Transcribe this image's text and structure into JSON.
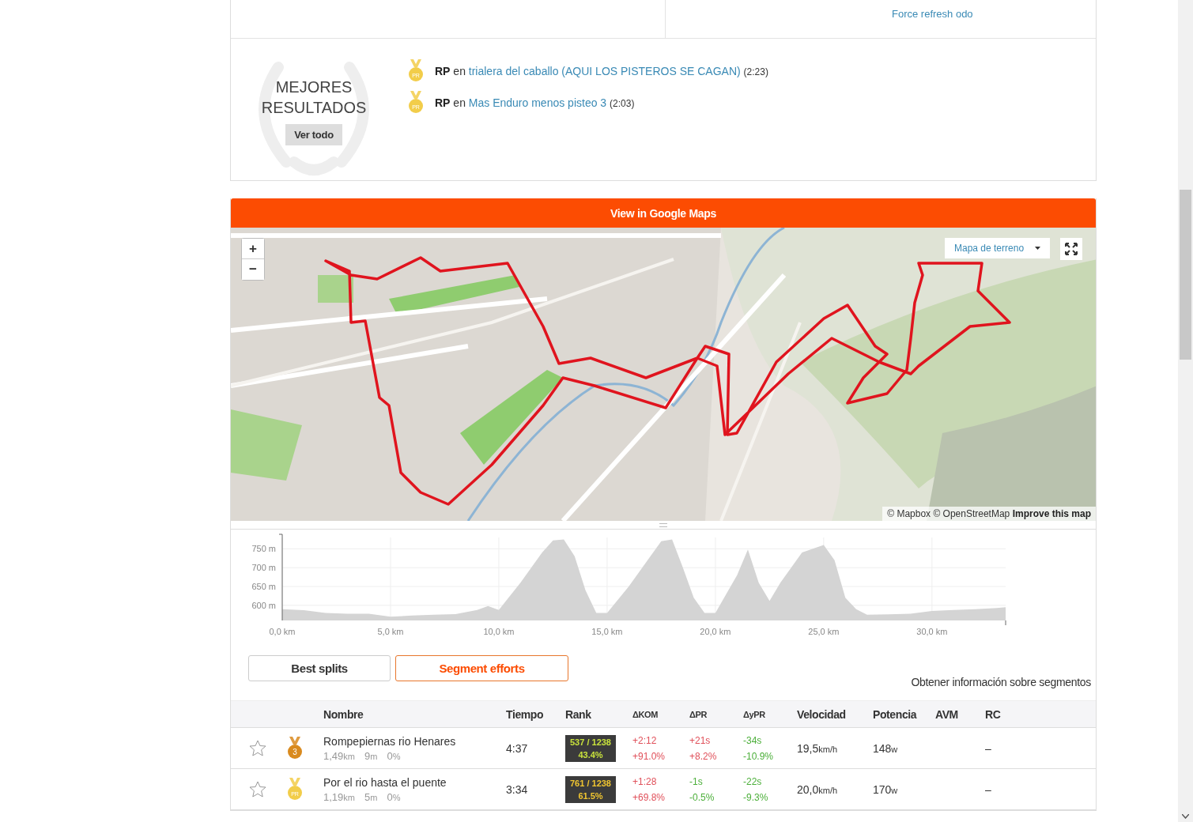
{
  "summary": {
    "refresh_link": "Force refresh odo"
  },
  "best_results": {
    "title_line1": "MEJORES",
    "title_line2": "RESULTADOS",
    "button": "Ver todo",
    "achievements": [
      {
        "medal": {
          "kind": "pr",
          "text": "PR"
        },
        "label": "RP",
        "connector": "en",
        "segment": "trialera del caballo (AQUI LOS PISTEROS SE CAGAN)",
        "time": "(2:23)"
      },
      {
        "medal": {
          "kind": "pr",
          "text": "PR"
        },
        "label": "RP",
        "connector": "en",
        "segment": "Mas Enduro menos pisteo 3",
        "time": "(2:03)"
      }
    ]
  },
  "map": {
    "header": "View in Google Maps",
    "zoom_in": "+",
    "zoom_out": "−",
    "layer_select": "Mapa de terreno",
    "attribution": "© Mapbox © OpenStreetMap **Improve this map**"
  },
  "elevation": {
    "chart_data": {
      "type": "area",
      "x": [
        0,
        1,
        2,
        3,
        4,
        5,
        6,
        7,
        8,
        9,
        9.5,
        10,
        11,
        12,
        12.5,
        13,
        13.5,
        14,
        14.5,
        15,
        16,
        17,
        17.5,
        18,
        18.5,
        19,
        19.5,
        20,
        21,
        21.5,
        22,
        22.5,
        23,
        24,
        25,
        25.5,
        26,
        26.5,
        27,
        28,
        29,
        30,
        31,
        32,
        33,
        33.4
      ],
      "grid": true,
      "series": [
        {
          "color": "#d4d4d4",
          "values": [
            590,
            587,
            580,
            578,
            578,
            570,
            573,
            575,
            577,
            588,
            598,
            588,
            660,
            740,
            772,
            775,
            730,
            640,
            580,
            580,
            650,
            730,
            770,
            775,
            700,
            620,
            580,
            580,
            680,
            748,
            660,
            612,
            660,
            740,
            760,
            720,
            620,
            590,
            575,
            576,
            578,
            585,
            588,
            590,
            593,
            595
          ]
        }
      ],
      "xlim": [
        0,
        33.4
      ],
      "ylim": [
        560,
        780
      ],
      "xticks": [
        {
          "value": 0,
          "label": "0,0 km"
        },
        {
          "value": 5,
          "label": "5,0 km"
        },
        {
          "value": 10,
          "label": "10,0 km"
        },
        {
          "value": 15,
          "label": "15,0 km"
        },
        {
          "value": 20,
          "label": "20,0 km"
        },
        {
          "value": 25,
          "label": "25,0 km"
        },
        {
          "value": 30,
          "label": "30,0 km"
        }
      ],
      "yticks": [
        {
          "value": 600,
          "label": "600 m"
        },
        {
          "value": 650,
          "label": "650 m"
        },
        {
          "value": 700,
          "label": "700 m"
        },
        {
          "value": 750,
          "label": "750 m"
        }
      ]
    }
  },
  "tabs": [
    {
      "label": "Best splits",
      "selected": false
    },
    {
      "label": "Segment efforts",
      "selected": true
    }
  ],
  "info_link": "Obtener información sobre segmentos",
  "table": {
    "columns": [
      "Nombre",
      "Tiempo",
      "Rank",
      "ΔKOM",
      "ΔPR",
      "ΔyPR",
      "Velocidad",
      "Potencia",
      "AVM",
      "RC"
    ],
    "rows": [
      {
        "starred": false,
        "medal": {
          "kind": "rank",
          "text": "3"
        },
        "name": "Rompepiernas rio Henares",
        "stats": [
          {
            "value": "1,49",
            "unit": "km"
          },
          {
            "value": "9",
            "unit": "m"
          },
          {
            "value": "0",
            "unit": "%"
          }
        ],
        "time": "4:37",
        "rank": {
          "position": "537 / 1238",
          "percent": "43.4%",
          "color": "#c8e23c"
        },
        "kom": [
          {
            "text": "+2:12",
            "color": "#e0505a"
          },
          {
            "text": "+91.0%",
            "color": "#e0505a"
          }
        ],
        "pr": [
          {
            "text": "+21s",
            "color": "#e0505a"
          },
          {
            "text": "+8.2%",
            "color": "#e0505a"
          }
        ],
        "ypr": [
          {
            "text": "-34s",
            "color": "#4caf3a"
          },
          {
            "text": "-10.9%",
            "color": "#4caf3a"
          }
        ],
        "speed": {
          "value": "19,5",
          "unit": "km/h"
        },
        "power": {
          "value": "148",
          "unit": "w"
        },
        "rc": "–"
      },
      {
        "starred": false,
        "medal": {
          "kind": "pr",
          "text": "PR"
        },
        "name": "Por el rio hasta el puente",
        "stats": [
          {
            "value": "1,19",
            "unit": "km"
          },
          {
            "value": "5",
            "unit": "m"
          },
          {
            "value": "0",
            "unit": "%"
          }
        ],
        "time": "3:34",
        "rank": {
          "position": "761 / 1238",
          "percent": "61.5%",
          "color": "#f0c530"
        },
        "kom": [
          {
            "text": "+1:28",
            "color": "#e0505a"
          },
          {
            "text": "+69.8%",
            "color": "#e0505a"
          }
        ],
        "pr": [
          {
            "text": "-1s",
            "color": "#4caf3a"
          },
          {
            "text": "-0.5%",
            "color": "#4caf3a"
          }
        ],
        "ypr": [
          {
            "text": "-22s",
            "color": "#4caf3a"
          },
          {
            "text": "-9.3%",
            "color": "#4caf3a"
          }
        ],
        "speed": {
          "value": "20,0",
          "unit": "km/h"
        },
        "power": {
          "value": "170",
          "unit": "w"
        },
        "rc": "–"
      }
    ]
  }
}
